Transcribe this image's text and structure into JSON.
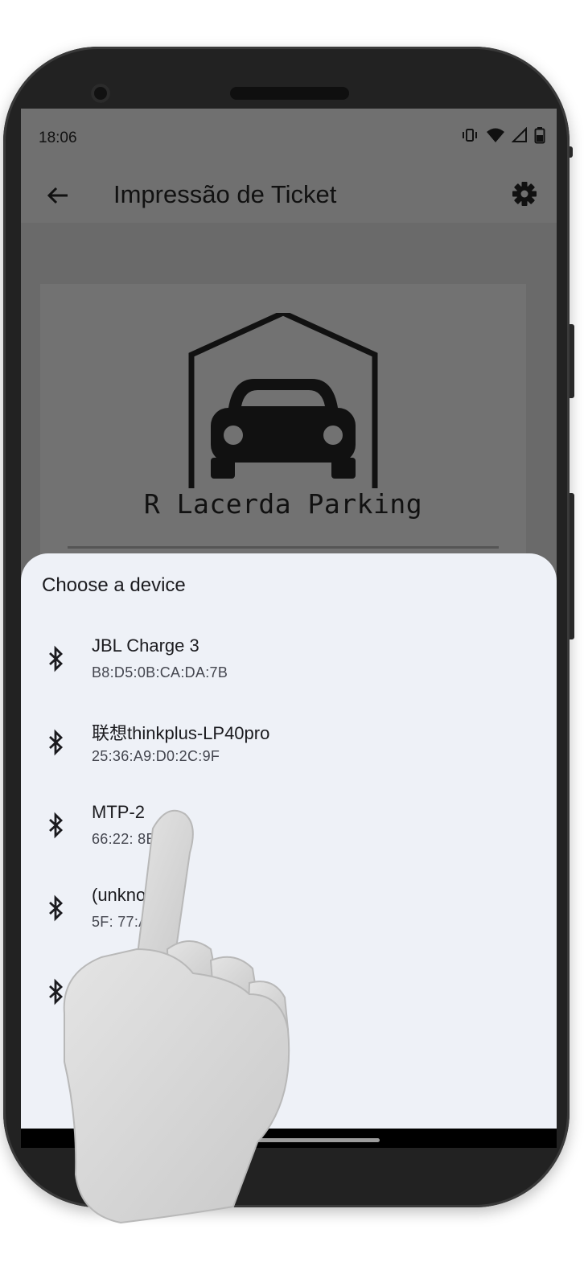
{
  "status_bar": {
    "time": "18:06"
  },
  "app_bar": {
    "title": "Impressão de Ticket"
  },
  "ticket": {
    "brand": "R Lacerda Parking"
  },
  "sheet": {
    "title": "Choose a device",
    "devices": [
      {
        "name": "JBL Charge 3",
        "address": "B8:D5:0B:CA:DA:7B"
      },
      {
        "name": "联想thinkplus-LP40pro",
        "address": "25:36:A9:D0:2C:9F"
      },
      {
        "name": "MTP-2",
        "address": "66:22:  8B:85"
      },
      {
        "name": "(unknown)",
        "address": "5F:  77:AE:9D"
      },
      {
        "name": "(",
        "address": ""
      }
    ]
  },
  "colors": {
    "sheet_background": "#eef1f7",
    "overlay": "#6b6b6b",
    "text_primary": "#1b1b1f"
  },
  "icons": {
    "back": "arrow-back-icon",
    "settings": "gear-icon",
    "device": "bluetooth-icon"
  }
}
